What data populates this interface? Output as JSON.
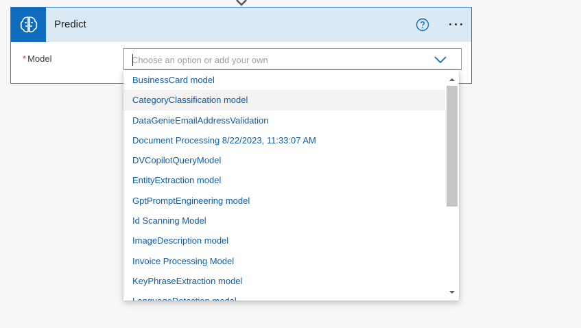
{
  "card": {
    "title": "Predict",
    "field": {
      "required_mark": "*",
      "label": "Model",
      "placeholder": "Choose an option or add your own",
      "value": ""
    }
  },
  "dropdown": {
    "options": [
      "BusinessCard model",
      "CategoryClassification model",
      "DataGenieEmailAddressValidation",
      "Document Processing 8/22/2023, 11:33:07 AM",
      "DVCopilotQueryModel",
      "EntityExtraction model",
      "GptPromptEngineering model",
      "Id Scanning Model",
      "ImageDescription model",
      "Invoice Processing Model",
      "KeyPhraseExtraction model",
      "LanguageDetection model"
    ],
    "highlighted_index": 1
  },
  "icons": {
    "connector": "down-arrow-icon",
    "action": "ai-brain-icon",
    "help": "help-circle-icon",
    "more": "more-ellipsis-icon",
    "expand": "chevron-down-icon"
  },
  "colors": {
    "accent": "#0f6cbd",
    "header_bg": "#dbe9f5",
    "option_text": "#0f5ca8",
    "required": "#c4314b"
  }
}
